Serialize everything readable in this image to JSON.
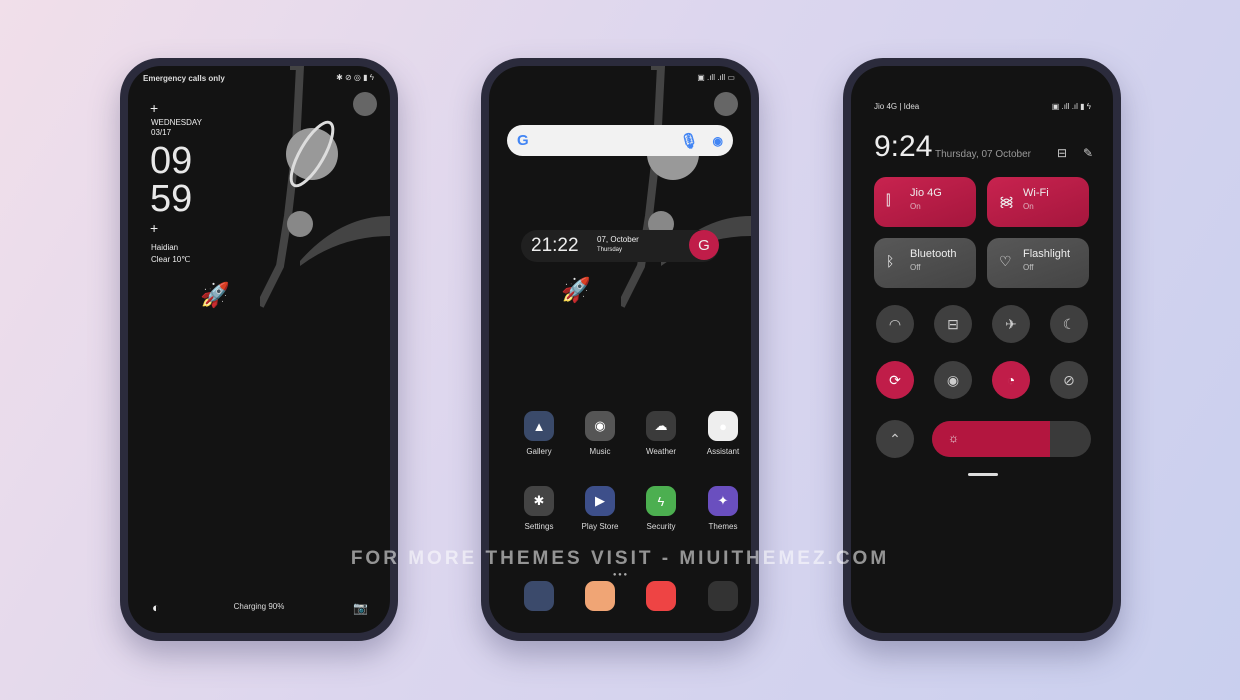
{
  "lockscreen": {
    "status": "Emergency calls only",
    "day": "WEDNESDAY",
    "date": "03/17",
    "hour": "09",
    "minute": "59",
    "city": "Haidian",
    "weather": "Clear  10℃",
    "charging": "Charging 90%"
  },
  "homescreen": {
    "clock": "21:22",
    "date": "07, October",
    "weekday": "Thursday",
    "apps": [
      {
        "label": "Gallery",
        "color": "#3a4a6a"
      },
      {
        "label": "Music",
        "color": "#555"
      },
      {
        "label": "Weather",
        "color": "#3b3b3b"
      },
      {
        "label": "Assistant",
        "color": "#eee"
      },
      {
        "label": "Settings",
        "color": "#444"
      },
      {
        "label": "Play Store",
        "color": "#3d4f8a"
      },
      {
        "label": "Security",
        "color": "#4caf50"
      },
      {
        "label": "Themes",
        "color": "#6a4fbf"
      }
    ],
    "dock": [
      {
        "name": "contacts",
        "color": "#3b4a6b"
      },
      {
        "name": "messages",
        "color": "#f0a575"
      },
      {
        "name": "chrome",
        "color": "#e44"
      },
      {
        "name": "camera",
        "color": "#333"
      }
    ]
  },
  "control_center": {
    "carrier": "Jio 4G | Idea",
    "time": "9:24",
    "date": "Thursday, 07 October",
    "tiles": [
      {
        "label": "Jio 4G",
        "state": "On"
      },
      {
        "label": "Wi-Fi",
        "state": "On"
      },
      {
        "label": "Bluetooth",
        "state": "Off"
      },
      {
        "label": "Flashlight",
        "state": "Off"
      }
    ],
    "brightness": 0.74,
    "accent": "#c01d49"
  },
  "watermark": "FOR MORE THEMES VISIT - MIUITHEMEZ.COM"
}
